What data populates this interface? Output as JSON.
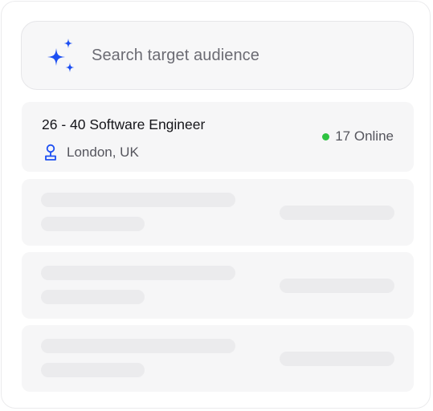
{
  "search": {
    "placeholder": "Search target audience",
    "icon": "sparkle-icon",
    "accent_color": "#1d4ff2"
  },
  "results": [
    {
      "role": "26 - 40 Software Engineer",
      "location": "London, UK",
      "location_icon": "location-pin-icon",
      "online_label": "17 Online",
      "online_color": "#2ec341"
    }
  ],
  "skeleton_rows": 3
}
